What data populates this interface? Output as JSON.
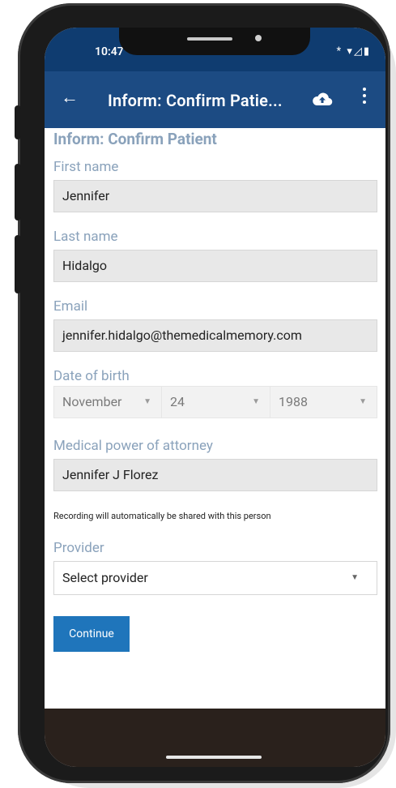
{
  "status_bar": {
    "time": "10:47",
    "icons": "* ▾◿▮"
  },
  "app_bar": {
    "title": "Inform: Confirm Patie..."
  },
  "form": {
    "heading": "Inform: Confirm Patient",
    "first_name": {
      "label": "First name",
      "value": "Jennifer"
    },
    "last_name": {
      "label": "Last name",
      "value": "Hidalgo"
    },
    "email": {
      "label": "Email",
      "value": "jennifer.hidalgo@themedicalmemory.com"
    },
    "dob": {
      "label": "Date of birth",
      "month": "November",
      "day": "24",
      "year": "1988"
    },
    "poa": {
      "label": "Medical power of attorney",
      "value": "Jennifer J Florez"
    },
    "note": "Recording will automatically be shared with this person",
    "provider": {
      "label": "Provider",
      "value": "Select provider"
    },
    "continue_label": "Continue"
  },
  "colors": {
    "status_bar": "#0f3c70",
    "app_bar": "#1c4b83",
    "label": "#8aa2bb",
    "button": "#1f75bb",
    "bottom_bar": "#2a211c"
  },
  "icons": [
    "back-arrow-icon",
    "cloud-upload-icon",
    "more-vert-icon",
    "caret-down-icon"
  ]
}
